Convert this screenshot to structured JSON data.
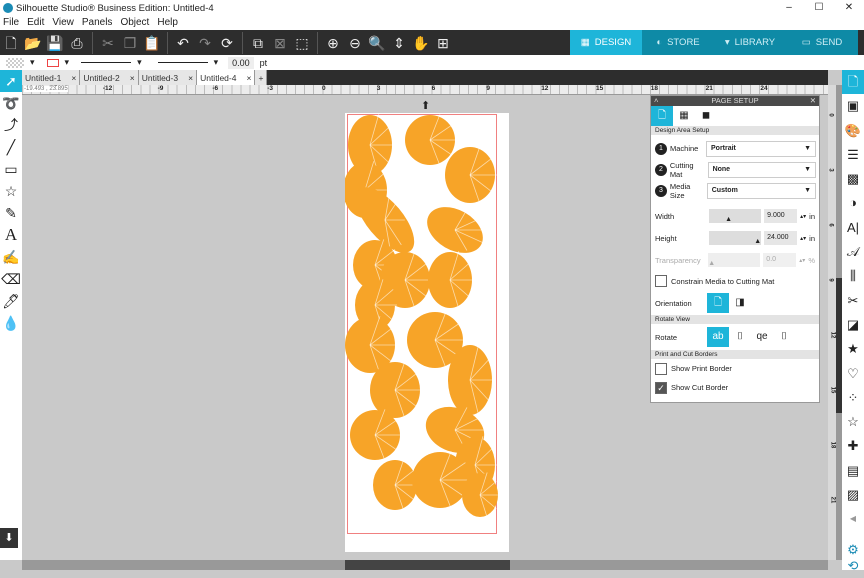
{
  "window": {
    "title": "Silhouette Studio® Business Edition: Untitled-4",
    "controls": [
      "–",
      "☐",
      "✕"
    ]
  },
  "menu": [
    "File",
    "Edit",
    "View",
    "Panels",
    "Object",
    "Help"
  ],
  "toolbar": {
    "icons": [
      "new-icon",
      "open-icon",
      "save-icon",
      "print-icon",
      "cut-icon",
      "copy-icon",
      "paste-icon",
      "undo-icon",
      "redo-icon",
      "replicate-icon",
      "group-icon",
      "ungroup-icon",
      "compound-icon",
      "zoom-in-icon",
      "zoom-out-icon",
      "zoom-select-icon",
      "fit-page-icon",
      "pan-icon",
      "add-page-icon"
    ]
  },
  "nav": [
    {
      "label": "DESIGN",
      "active": true
    },
    {
      "label": "STORE"
    },
    {
      "label": "LIBRARY"
    },
    {
      "label": "SEND"
    }
  ],
  "props": {
    "line_width": "0.00",
    "unit": "pt"
  },
  "tabs": [
    "Untitled-1",
    "Untitled-2",
    "Untitled-3",
    "Untitled-4"
  ],
  "active_tab": "Untitled-4",
  "coords": "-19.493 , 23.895",
  "ruler": {
    "h_labels": [
      "-15",
      "-12",
      "-9",
      "-6",
      "-3",
      "0",
      "3",
      "6",
      "9",
      "12",
      "15",
      "18",
      "21",
      "24"
    ],
    "v_labels": [
      "0",
      "3",
      "6",
      "9",
      "12",
      "15",
      "18",
      "21"
    ]
  },
  "colors": {
    "accent": "#1eb5d9",
    "leaves": "#f7a428",
    "cut_border": "#f08080"
  },
  "panel": {
    "title": "PAGE SETUP",
    "section1": "Design Area Setup",
    "machine_label": "Machine",
    "machine": "Portrait",
    "mat_label": "Cutting Mat",
    "mat": "None",
    "media_label": "Media Size",
    "media": "Custom",
    "width_label": "Width",
    "width": "9.000",
    "height_label": "Height",
    "height": "24.000",
    "unit": "in",
    "transparency_label": "Transparency",
    "transparency": "0.0",
    "pct": "%",
    "constrain": "Constrain Media to Cutting Mat",
    "orientation_label": "Orientation",
    "section2": "Rotate View",
    "rotate_label": "Rotate",
    "section3": "Print and Cut Borders",
    "print_border": "Show Print Border",
    "print_border_checked": false,
    "cut_border": "Show Cut Border",
    "cut_border_checked": true
  }
}
